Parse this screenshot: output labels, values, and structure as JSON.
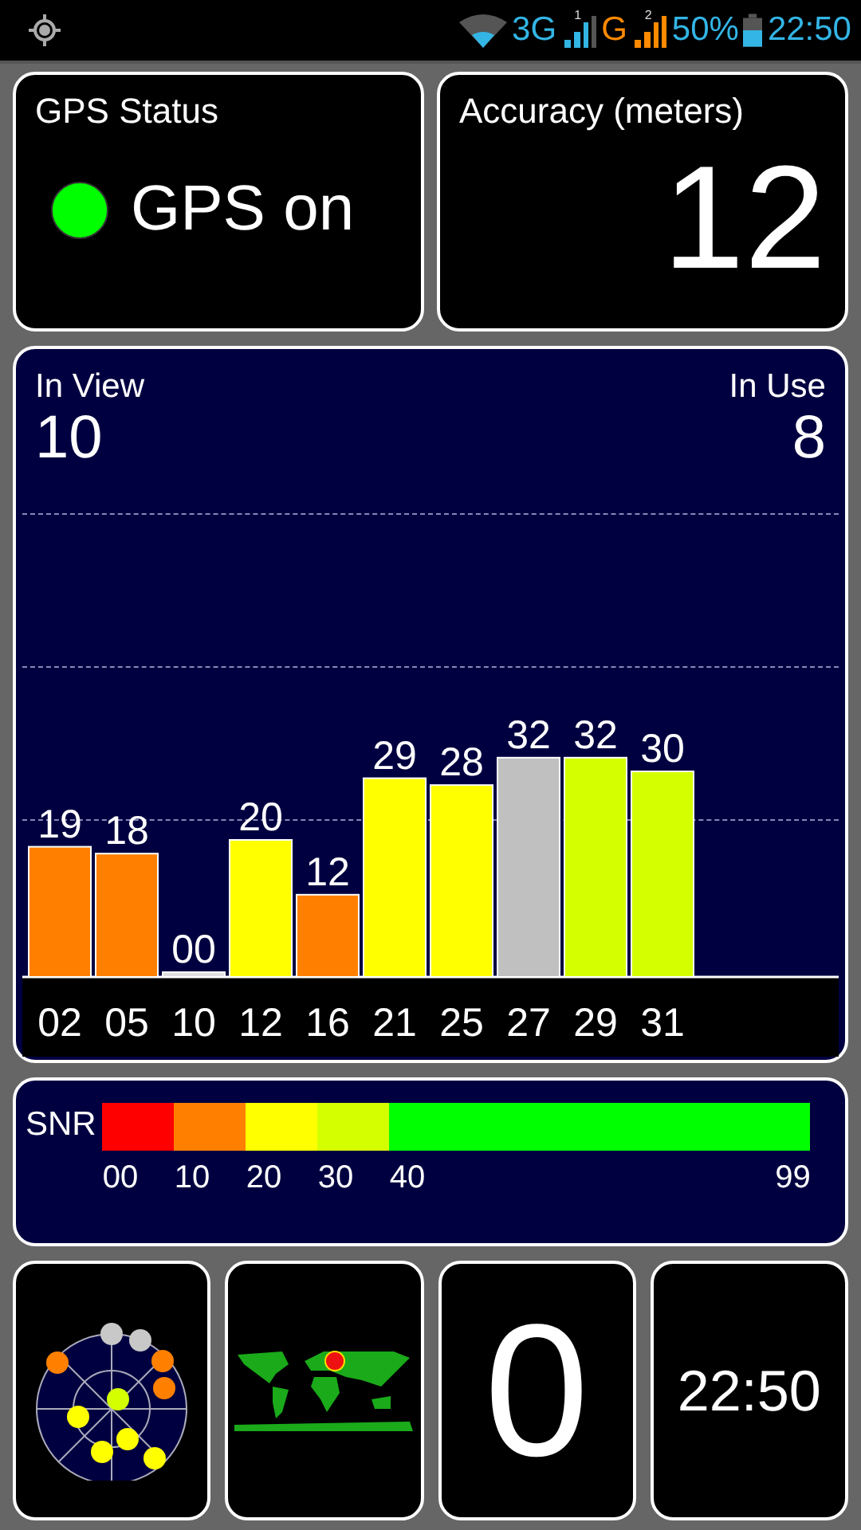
{
  "status_bar": {
    "network_3g": "3G",
    "sim1_index": "1",
    "network_g": "G",
    "sim2_index": "2",
    "battery": "50%",
    "time": "22:50"
  },
  "gps_status": {
    "title": "GPS Status",
    "value": "GPS on",
    "on": true
  },
  "accuracy": {
    "title": "Accuracy (meters)",
    "value": "12"
  },
  "satellites": {
    "in_view_label": "In View",
    "in_view": "10",
    "in_use_label": "In Use",
    "in_use": "8",
    "chart_data": {
      "type": "bar",
      "categories": [
        "02",
        "05",
        "10",
        "12",
        "16",
        "21",
        "25",
        "27",
        "29",
        "31"
      ],
      "values": [
        19,
        18,
        0,
        20,
        12,
        29,
        28,
        32,
        32,
        30
      ],
      "value_labels": [
        "19",
        "18",
        "00",
        "20",
        "12",
        "29",
        "28",
        "32",
        "32",
        "30"
      ]
    },
    "used": [
      true,
      true,
      false,
      true,
      true,
      true,
      true,
      false,
      true,
      true
    ]
  },
  "snr": {
    "label": "SNR",
    "segments": [
      {
        "color": "#ff0000"
      },
      {
        "color": "#ff8000"
      },
      {
        "color": "#ffff00"
      },
      {
        "color": "#d4ff00"
      },
      {
        "color": "#00ff00"
      }
    ],
    "ticks": [
      "00",
      "10",
      "20",
      "30",
      "40",
      "99"
    ]
  },
  "tiles": {
    "count": "0",
    "clock": "22:50"
  }
}
